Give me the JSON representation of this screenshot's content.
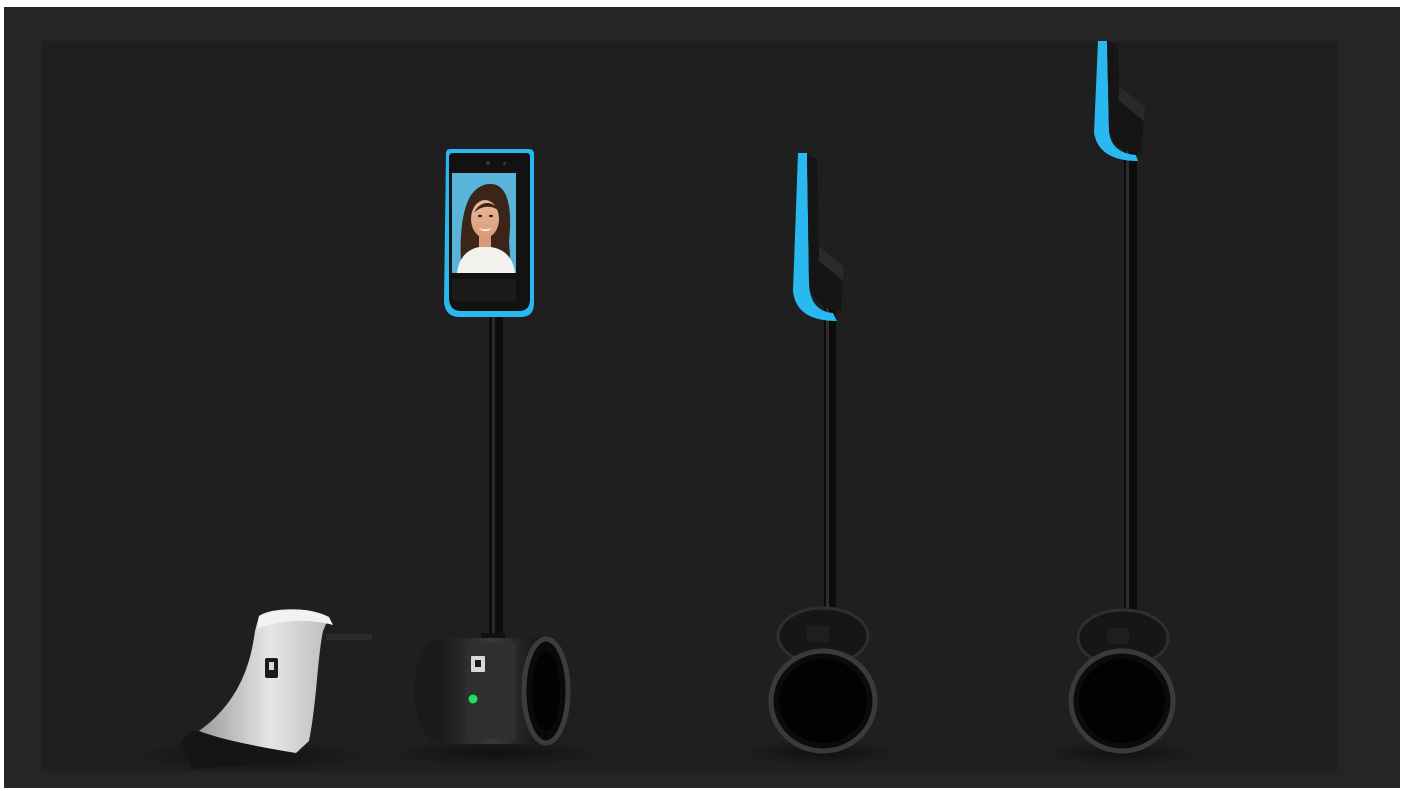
{
  "image": {
    "description_kind": "product-render",
    "palette": {
      "frame": "#252525",
      "backdrop": "#1f1f1f",
      "accent_blue": "#29b8f0",
      "body_black": "#0c0c0c",
      "dock_white": "#d8d8d8",
      "screen_bg": "#5ab3d9",
      "status_led": "#22dd66"
    }
  },
  "objects": [
    {
      "id": "charging-dock"
    },
    {
      "id": "robot-front-view"
    },
    {
      "id": "robot-side-view-short"
    },
    {
      "id": "robot-side-view-tall"
    }
  ]
}
